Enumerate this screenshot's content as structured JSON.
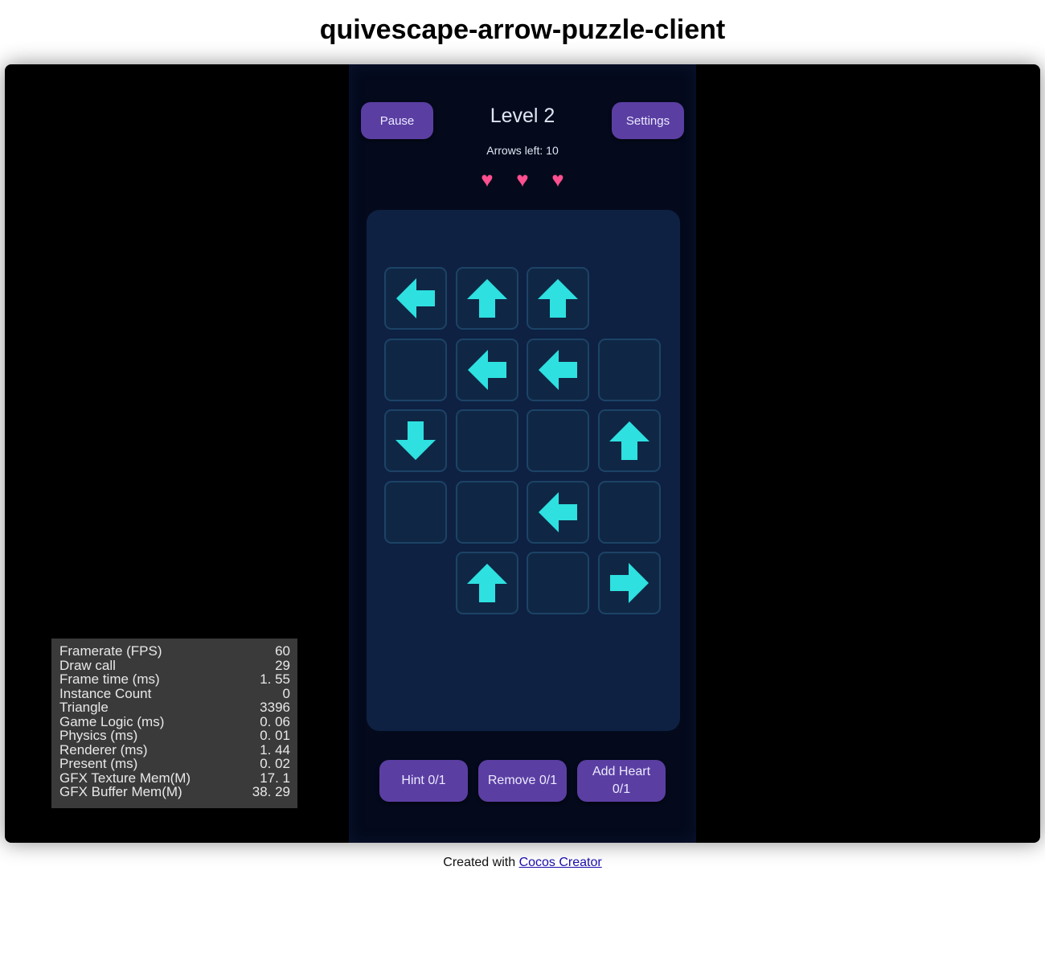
{
  "page": {
    "title": "quivescape-arrow-puzzle-client",
    "footer_prefix": "Created with",
    "footer_link": "Cocos Creator"
  },
  "game": {
    "pause_label": "Pause",
    "settings_label": "Settings",
    "level_title": "Level 2",
    "arrows_left": "Arrows left: 10",
    "hearts": [
      "♥",
      "♥",
      "♥"
    ],
    "heart_color": "#ff4f8f",
    "arrow_color": "#2ee0e0",
    "button_color": "#5b3ea2",
    "grid": [
      [
        "left",
        "up",
        "up",
        null
      ],
      [
        "empty",
        "left",
        "left",
        "empty"
      ],
      [
        "down",
        "empty",
        "empty",
        "up"
      ],
      [
        "empty",
        "empty",
        "left",
        "empty"
      ],
      [
        null,
        "up",
        "empty",
        "right"
      ]
    ],
    "bottom_buttons": {
      "hint": "Hint  0/1",
      "remove": "Remove  0/1",
      "add_heart": "Add Heart 0/1"
    }
  },
  "stats": [
    {
      "label": "Framerate (FPS)",
      "value": "60"
    },
    {
      "label": "Draw call",
      "value": "29"
    },
    {
      "label": "Frame time (ms)",
      "value": "1. 55"
    },
    {
      "label": "Instance Count",
      "value": "0"
    },
    {
      "label": "Triangle",
      "value": "3396"
    },
    {
      "label": "Game Logic (ms)",
      "value": "0. 06"
    },
    {
      "label": "Physics (ms)",
      "value": "0. 01"
    },
    {
      "label": "Renderer (ms)",
      "value": "1. 44"
    },
    {
      "label": "Present (ms)",
      "value": "0. 02"
    },
    {
      "label": "GFX Texture Mem(M)",
      "value": "17. 1"
    },
    {
      "label": "GFX Buffer Mem(M)",
      "value": "38. 29"
    }
  ]
}
